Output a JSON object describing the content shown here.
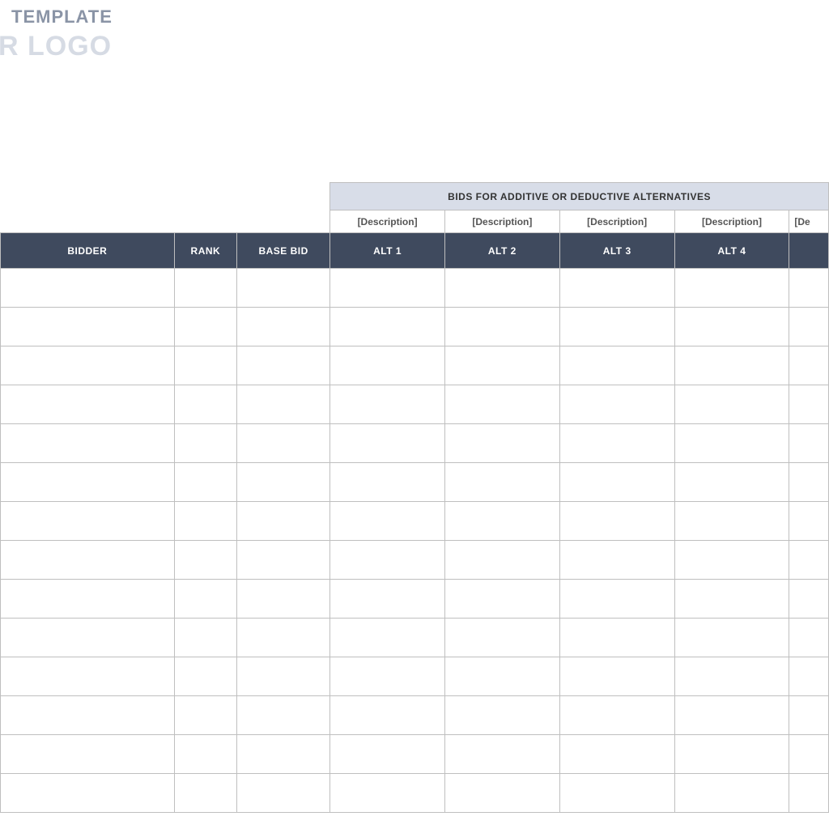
{
  "header": {
    "title_fragment": "TEMPLATE",
    "logo_fragment": "R LOGO"
  },
  "table": {
    "group_header": "BIDS FOR ADDITIVE OR DEDUCTIVE ALTERNATIVES",
    "desc_placeholder": "[Description]",
    "desc_placeholder_cut": "[De",
    "columns": {
      "bidder": "BIDDER",
      "rank": "RANK",
      "base_bid": "BASE BID",
      "alt1": "ALT 1",
      "alt2": "ALT 2",
      "alt3": "ALT 3",
      "alt4": "ALT 4"
    },
    "row_count": 14
  }
}
